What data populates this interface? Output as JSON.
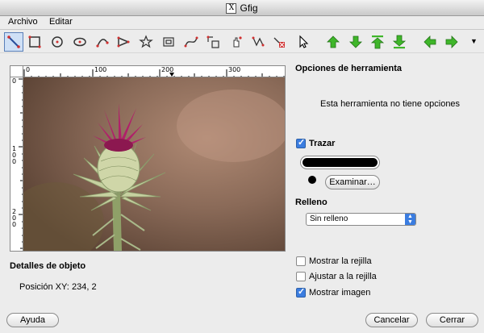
{
  "window": {
    "title": "Gfig",
    "app_icon": "x-icon"
  },
  "menubar": {
    "items": [
      {
        "label": "Archivo",
        "mnemonic": "A"
      },
      {
        "label": "Editar",
        "mnemonic": "E"
      }
    ]
  },
  "toolbar": {
    "tools": [
      {
        "name": "line-icon",
        "active": true
      },
      {
        "name": "rectangle-icon"
      },
      {
        "name": "circle-icon"
      },
      {
        "name": "ellipse-icon"
      },
      {
        "name": "arc-icon"
      },
      {
        "name": "polygon-icon"
      },
      {
        "name": "star-icon"
      },
      {
        "name": "spiral-icon"
      },
      {
        "name": "bezier-icon"
      },
      {
        "name": "move-object-icon"
      },
      {
        "name": "move-point-icon"
      },
      {
        "name": "copy-object-icon"
      },
      {
        "name": "delete-object-icon"
      },
      {
        "name": "select-object-icon"
      },
      {
        "name": "raise-icon"
      },
      {
        "name": "lower-icon"
      },
      {
        "name": "raise-to-top-icon"
      },
      {
        "name": "lower-to-bottom-icon"
      },
      {
        "name": "previous-icon"
      },
      {
        "name": "next-icon"
      }
    ],
    "overflow_icon": "overflow-arrow-icon",
    "accent_green": "#3fb62a"
  },
  "ruler": {
    "h_labels": [
      "0",
      "100",
      "200",
      "300"
    ],
    "v_labels": [
      "0",
      "1 0 0",
      "2 0 0"
    ]
  },
  "object_details": {
    "title": "Detalles de objeto",
    "position_label": "Posición XY:",
    "position_value": "234, 2"
  },
  "tool_options": {
    "title": "Opciones de herramienta",
    "no_options_text": "Esta herramienta no tiene opciones"
  },
  "stroke": {
    "label": "Trazar",
    "mnemonic": "T",
    "checked": true,
    "color": "#000000",
    "browse_label": "Examinar…"
  },
  "fill": {
    "title": "Relleno",
    "selected": "Sin relleno"
  },
  "grid": {
    "show_grid": {
      "label": "Mostrar la rejilla",
      "checked": false
    },
    "snap_grid": {
      "label": "Ajustar a la rejilla",
      "checked": false
    },
    "show_image": {
      "label": "Mostrar imagen",
      "checked": true
    }
  },
  "buttons": {
    "help": "Ayuda",
    "cancel": "Cancelar",
    "close": "Cerrar"
  }
}
